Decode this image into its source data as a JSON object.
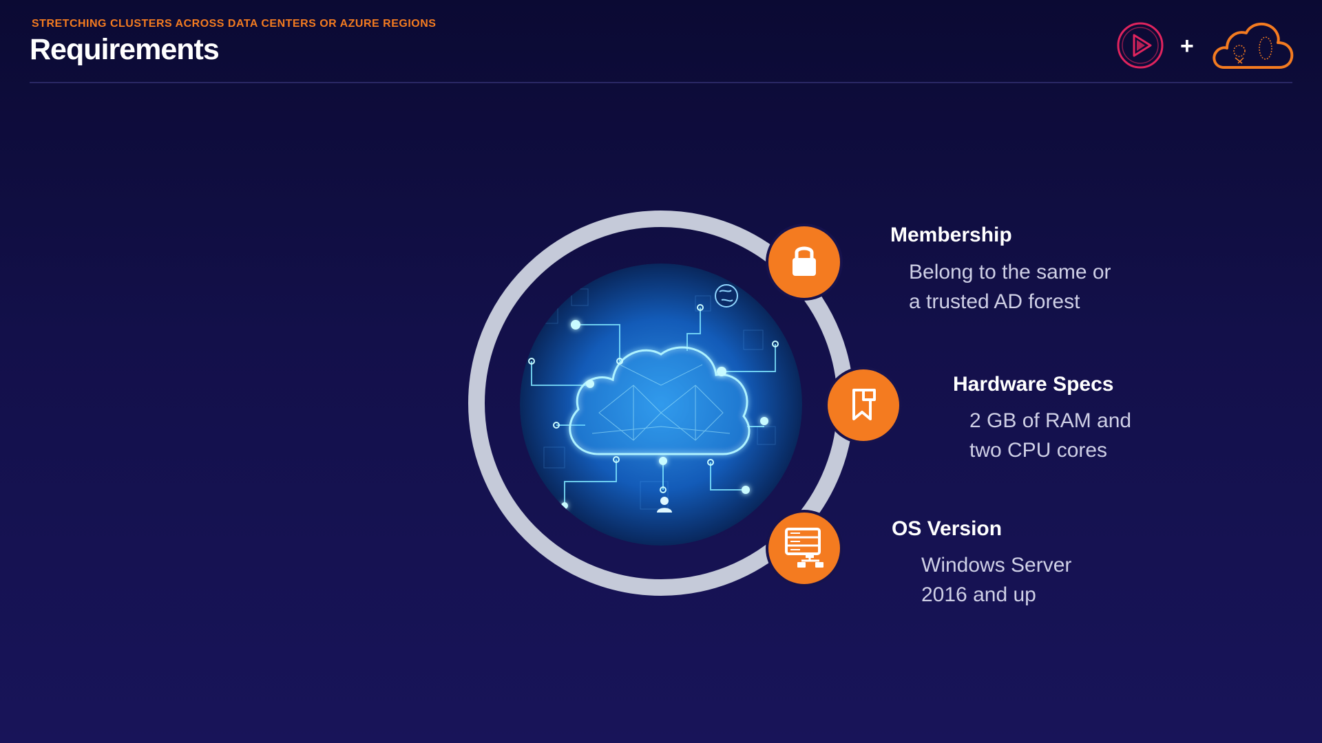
{
  "header": {
    "kicker": "STRETCHING CLUSTERS ACROSS DATA CENTERS OR AZURE REGIONS",
    "title": "Requirements",
    "logo_separator": "+"
  },
  "colors": {
    "accent": "#f47b20",
    "background": "#13104a",
    "ring": "#c5cad9",
    "logo_play": "#e0245e"
  },
  "requirements": [
    {
      "icon": "lock-icon",
      "title": "Membership",
      "desc_line1": "Belong to the same or",
      "desc_line2": "a trusted AD forest"
    },
    {
      "icon": "bookmark-icon",
      "title": "Hardware Specs",
      "desc_line1": "2 GB of RAM and",
      "desc_line2": "two CPU cores"
    },
    {
      "icon": "server-network-icon",
      "title": "OS Version",
      "desc_line1": "Windows Server",
      "desc_line2": "2016 and up"
    }
  ],
  "illustration": {
    "subject": "cloud-network-icon"
  }
}
